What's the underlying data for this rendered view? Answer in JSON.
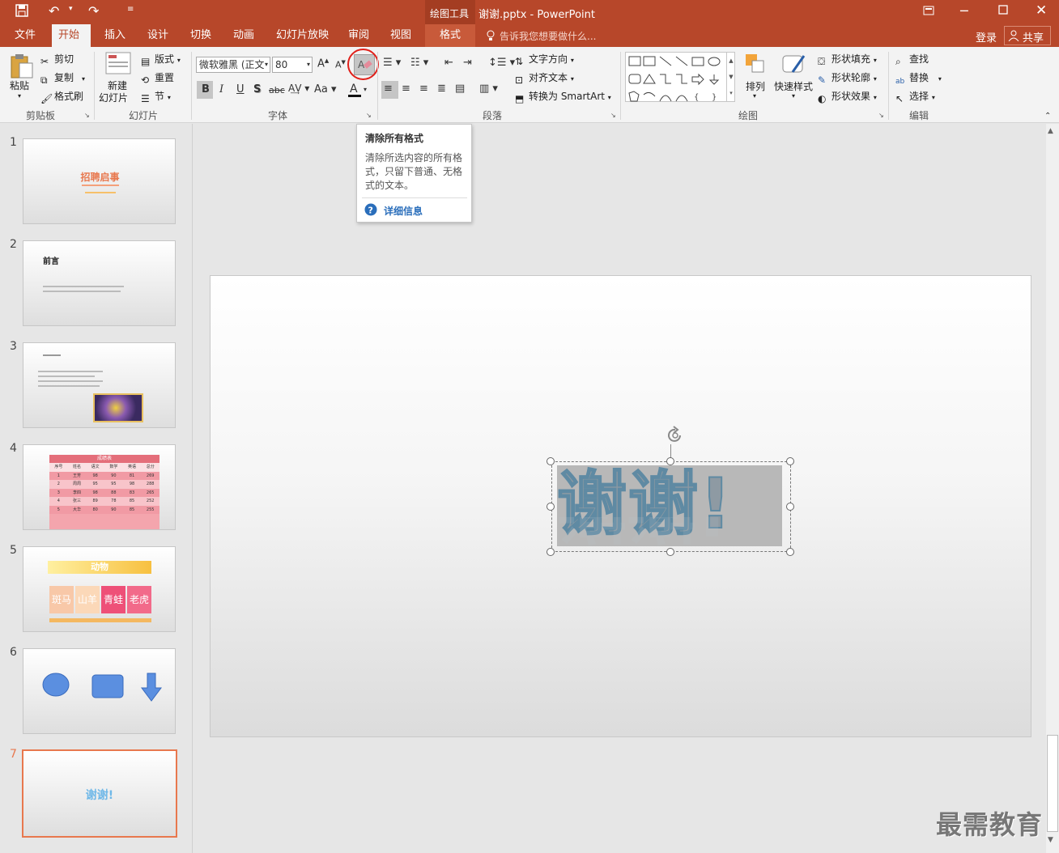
{
  "titlebar": {
    "context_tools": "绘图工具",
    "title": "谢谢.pptx - PowerPoint"
  },
  "tabs": [
    "文件",
    "开始",
    "插入",
    "设计",
    "切换",
    "动画",
    "幻灯片放映",
    "审阅",
    "视图"
  ],
  "context_tab": "格式",
  "tell_me": "告诉我您想要做什么...",
  "signin": "登录",
  "share": "共享",
  "clipboard": {
    "paste": "粘贴",
    "cut": "剪切",
    "copy": "复制",
    "format_painter": "格式刷",
    "label": "剪贴板"
  },
  "slides_group": {
    "new_slide": "新建",
    "new_slide2": "幻灯片",
    "layout": "版式",
    "reset": "重置",
    "section": "节",
    "label": "幻灯片"
  },
  "font_group": {
    "font_name": "微软雅黑 (正文",
    "font_size": "80",
    "label": "字体"
  },
  "paragraph_group": {
    "text_direction": "文字方向",
    "align_text": "对齐文本",
    "smartart": "转换为 SmartArt",
    "label": "段落"
  },
  "drawing_group": {
    "arrange": "排列",
    "quick_styles": "快速样式",
    "shape_fill": "形状填充",
    "shape_outline": "形状轮廓",
    "shape_effects": "形状效果",
    "label": "绘图"
  },
  "editing_group": {
    "find": "查找",
    "replace": "替换",
    "select": "选择",
    "label": "编辑"
  },
  "tooltip": {
    "title": "清除所有格式",
    "body": "清除所选内容的所有格式，只留下普通、无格式的文本。",
    "more": "详细信息"
  },
  "thumbnails": {
    "nums": [
      "1",
      "2",
      "3",
      "4",
      "5",
      "6",
      "7"
    ],
    "s1_title": "招聘启事",
    "s2_title": "前言",
    "s4_title": "成绩表",
    "s4_headers": [
      "序号",
      "姓名",
      "语文",
      "数学",
      "英语",
      "总分"
    ],
    "s4_rows": [
      [
        "1",
        "王芳",
        "98",
        "90",
        "81",
        "269"
      ],
      [
        "2",
        "周周",
        "95",
        "95",
        "98",
        "288"
      ],
      [
        "3",
        "李四",
        "98",
        "88",
        "83",
        "265"
      ],
      [
        "4",
        "张三",
        "89",
        "78",
        "85",
        "252"
      ],
      [
        "5",
        "大华",
        "80",
        "90",
        "85",
        "255"
      ]
    ],
    "s5_title": "动物",
    "s5_cells": [
      "斑马",
      "山羊",
      "青蛙",
      "老虎"
    ],
    "s7_text": "谢谢!"
  },
  "slide_text": "谢谢!",
  "watermark": "最需教育",
  "colors": {
    "accent": "#b7472a",
    "selected_border": "#e8784e"
  }
}
